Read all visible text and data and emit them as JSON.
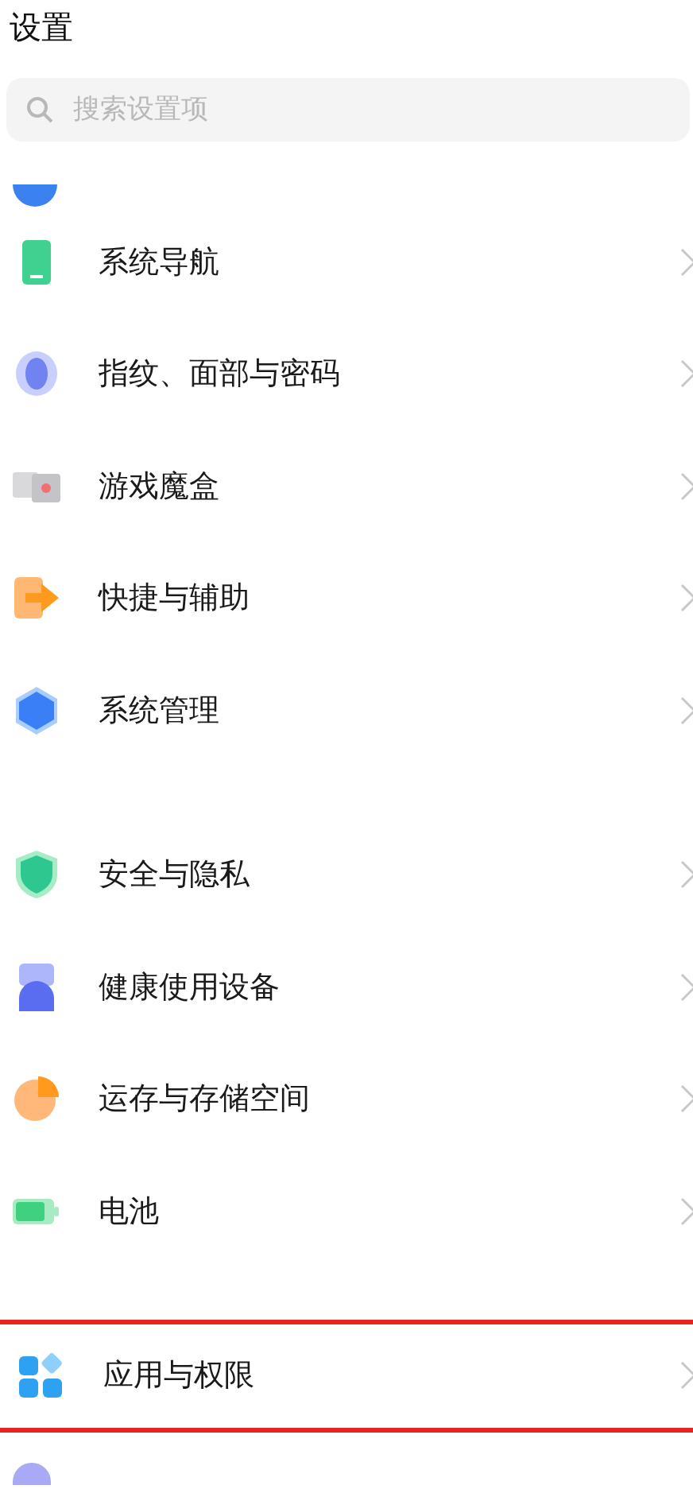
{
  "title": "设置",
  "search": {
    "placeholder": "搜索设置项"
  },
  "groups": [
    {
      "items": [
        {
          "label": "系统导航",
          "highlighted": false
        },
        {
          "label": "指纹、面部与密码",
          "highlighted": false
        },
        {
          "label": "游戏魔盒",
          "highlighted": false
        },
        {
          "label": "快捷与辅助",
          "highlighted": false
        },
        {
          "label": "系统管理",
          "highlighted": false
        }
      ]
    },
    {
      "items": [
        {
          "label": "安全与隐私",
          "highlighted": false
        },
        {
          "label": "健康使用设备",
          "highlighted": false
        },
        {
          "label": "运存与存储空间",
          "highlighted": false
        },
        {
          "label": "电池",
          "highlighted": false
        }
      ]
    },
    {
      "items": [
        {
          "label": "应用与权限",
          "highlighted": true
        }
      ]
    }
  ]
}
